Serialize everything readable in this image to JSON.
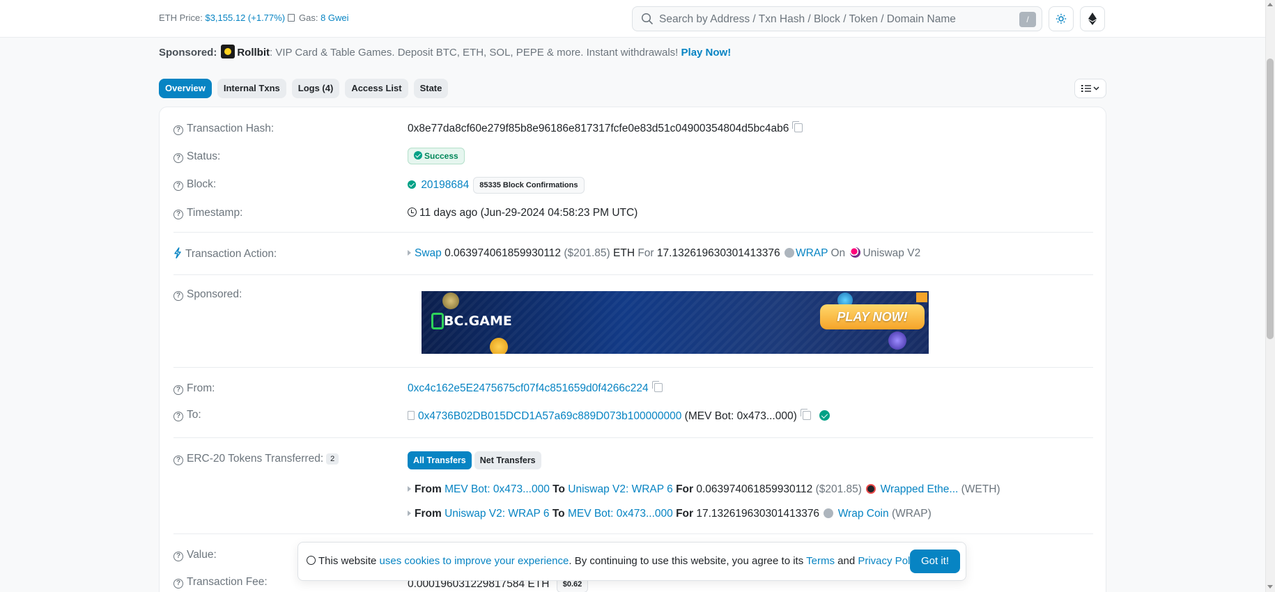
{
  "header": {
    "eth_price_label": "ETH Price:",
    "eth_price_value": "$3,155.12 (+1.77%)",
    "gas_label": "Gas:",
    "gas_value": "8 Gwei",
    "search_placeholder": "Search by Address / Txn Hash / Block / Token / Domain Name",
    "search_shortcut": "/"
  },
  "sponsor_line": {
    "label": "Sponsored:",
    "brand": "Rollbit",
    "text": ": VIP Card & Table Games. Deposit BTC, ETH, SOL, PEPE & more. Instant withdrawals!",
    "cta": "Play Now!"
  },
  "tabs": [
    {
      "label": "Overview",
      "active": true
    },
    {
      "label": "Internal Txns",
      "active": false
    },
    {
      "label": "Logs (4)",
      "active": false
    },
    {
      "label": "Access List",
      "active": false
    },
    {
      "label": "State",
      "active": false
    }
  ],
  "overview": {
    "hash_label": "Transaction Hash:",
    "hash_value": "0x8e77da8cf60e279f85b8e96186e817317fcfe0e83d51c04900354804d5bc4ab6",
    "status_label": "Status:",
    "status_value": "Success",
    "block_label": "Block:",
    "block_value": "20198684",
    "block_confirmations": "85335 Block Confirmations",
    "timestamp_label": "Timestamp:",
    "timestamp_value": "11 days ago (Jun-29-2024 04:58:23 PM UTC)",
    "action_label": "Transaction Action:",
    "action": {
      "verb": "Swap",
      "amount_in": "0.063974061859930112",
      "amount_in_usd": "($201.85)",
      "token_in": "ETH",
      "for": "For",
      "amount_out": "17.132619630301413376",
      "token_out": "WRAP",
      "on": "On",
      "dex": "Uniswap V2"
    },
    "sponsored_label": "Sponsored:",
    "banner": {
      "brand": "BC.GAME",
      "cta": "PLAY NOW!"
    },
    "from_label": "From:",
    "from_value": "0xc4c162e5E2475675cf07f4c851659d0f4266c224",
    "to_label": "To:",
    "to_value": "0x4736B02DB015DCD1A57a69c889D073b100000000",
    "to_name": "(MEV Bot: 0x473...000)",
    "erc20_label": "ERC-20 Tokens Transferred:",
    "erc20_count": "2",
    "transfer_buttons": {
      "all": "All Transfers",
      "net": "Net Transfers"
    },
    "transfers": [
      {
        "from_kw": "From",
        "from": "MEV Bot: 0x473...000",
        "to_kw": "To",
        "to": "Uniswap V2: WRAP 6",
        "for_kw": "For",
        "amount": "0.063974061859930112",
        "usd": "($201.85)",
        "token": "Wrapped Ethe...",
        "symbol": "(WETH)"
      },
      {
        "from_kw": "From",
        "from": "Uniswap V2: WRAP 6",
        "to_kw": "To",
        "to": "MEV Bot: 0x473...000",
        "for_kw": "For",
        "amount": "17.132619630301413376",
        "usd": "",
        "token": "Wrap Coin",
        "symbol": "(WRAP)"
      }
    ],
    "value_label": "Value:",
    "fee_label": "Transaction Fee:",
    "fee_value": "0.000196031229817584 ETH",
    "fee_usd": "$0.62"
  },
  "cookie": {
    "text_before": "This website",
    "link": "uses cookies to improve your experience",
    "text_middle": ". By continuing to use this website, you agree to its",
    "terms": "Terms",
    "and": "and",
    "privacy": "Privacy Policy",
    "period": ".",
    "button": "Got it!"
  },
  "colors": {
    "accent": "#0784c3",
    "success": "#00a186",
    "muted": "#6c757d"
  }
}
